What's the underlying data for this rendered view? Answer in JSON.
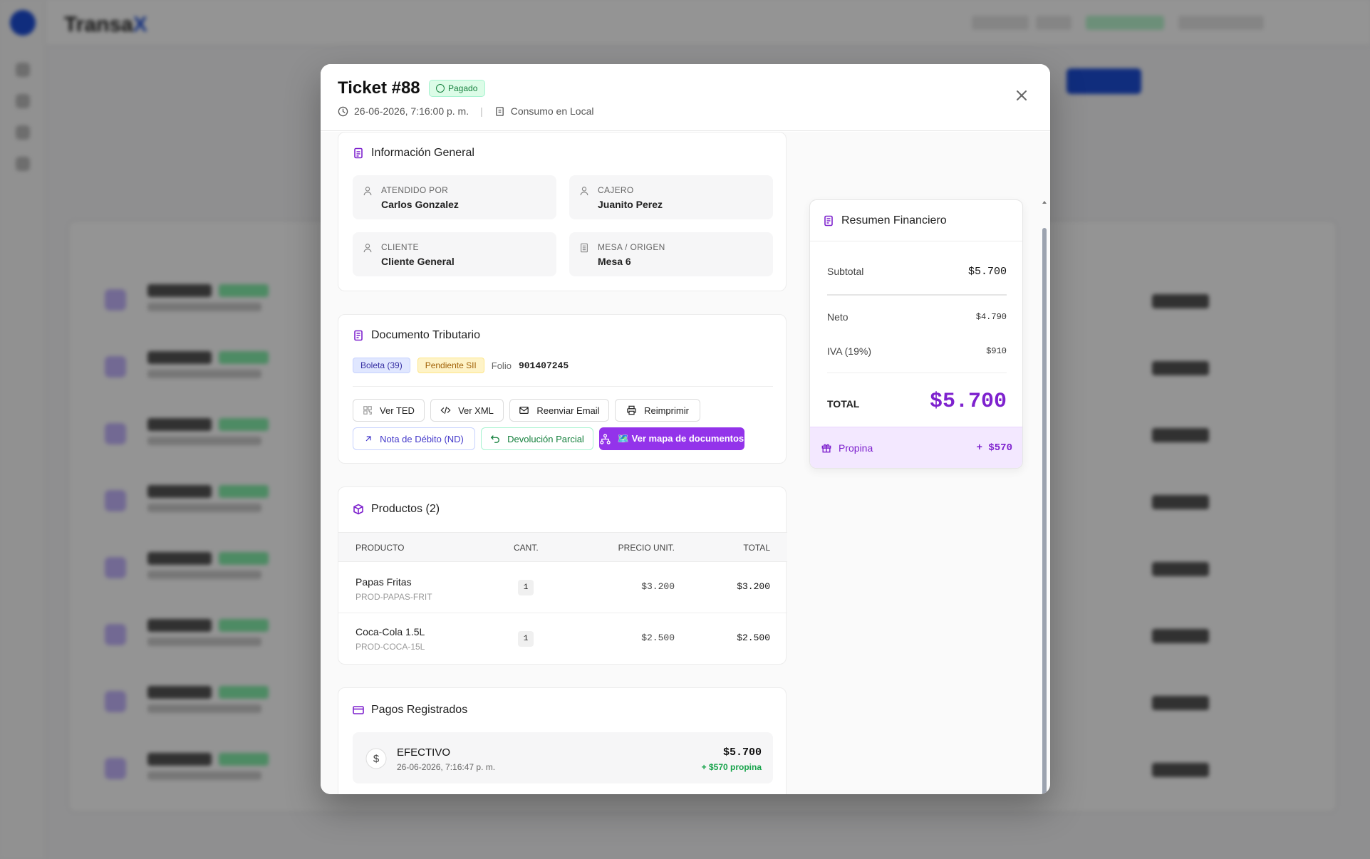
{
  "modal": {
    "title": "Ticket #88",
    "status_badge": "Pagado",
    "datetime": "26-06-2026, 7:16:00 p. m.",
    "consumption_type": "Consumo en Local"
  },
  "general_info": {
    "title": "Información General",
    "attended_by_label": "ATENDIDO POR",
    "attended_by": "Carlos Gonzalez",
    "cashier_label": "CAJERO",
    "cashier": "Juanito Perez",
    "client_label": "CLIENTE",
    "client": "Cliente General",
    "table_label": "MESA / ORIGEN",
    "table": "Mesa 6"
  },
  "tax_document": {
    "title": "Documento Tributario",
    "doc_type": "Boleta (39)",
    "sii_status": "Pendiente SII",
    "folio_label": "Folio",
    "folio": "901407245",
    "buttons": {
      "ted": "Ver TED",
      "xml": "Ver XML",
      "email": "Reenviar Email",
      "reprint": "Reimprimir",
      "debit_note": "Nota de Débito (ND)",
      "partial_refund": "Devolución Parcial",
      "map": "🗺️ Ver mapa de documentos"
    }
  },
  "products": {
    "title": "Productos (2)",
    "columns": [
      "PRODUCTO",
      "CANT.",
      "PRECIO UNIT.",
      "TOTAL"
    ],
    "rows": [
      {
        "name": "Papas Fritas",
        "sku": "PROD-PAPAS-FRIT",
        "qty": "1",
        "unit_price": "$3.200",
        "total": "$3.200"
      },
      {
        "name": "Coca-Cola 1.5L",
        "sku": "PROD-COCA-15L",
        "qty": "1",
        "unit_price": "$2.500",
        "total": "$2.500"
      }
    ]
  },
  "payments": {
    "title": "Pagos Registrados",
    "method": "EFECTIVO",
    "datetime": "26-06-2026, 7:16:47 p. m.",
    "amount": "$5.700",
    "tip": "+ $570 propina"
  },
  "financial": {
    "title": "Resumen Financiero",
    "subtotal_label": "Subtotal",
    "subtotal": "$5.700",
    "neto_label": "Neto",
    "neto": "$4.790",
    "iva_label": "IVA (19%)",
    "iva": "$910",
    "total_label": "TOTAL",
    "total": "$5.700",
    "tip_label": "Propina",
    "tip": "+ $570"
  },
  "colors": {
    "accent": "#9333ea",
    "success": "#15803d",
    "warning": "#a16207",
    "info": "#3730a3"
  }
}
